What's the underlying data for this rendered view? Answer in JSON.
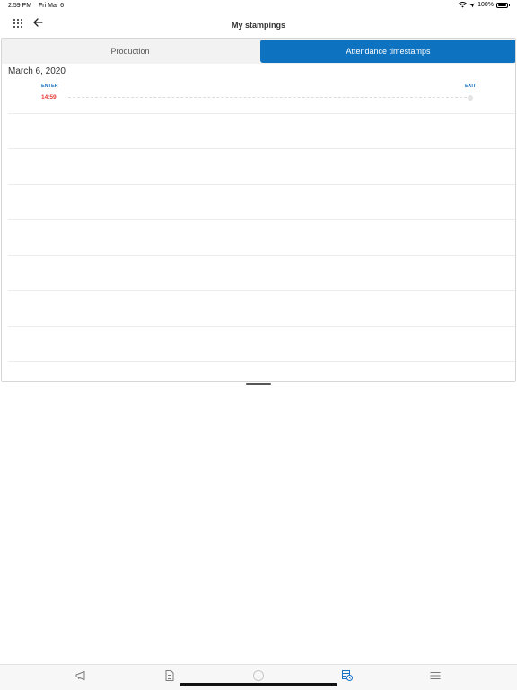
{
  "status_bar": {
    "time": "2:59 PM",
    "date": "Fri Mar 6",
    "battery": "100%"
  },
  "nav": {
    "title": "My stampings"
  },
  "tabs": [
    {
      "label": "Production",
      "selected": false
    },
    {
      "label": "Attendance timestamps",
      "selected": true
    }
  ],
  "colors": {
    "accent": "#0d72bf",
    "enter_time": "#e53935",
    "label": "#1a73c7"
  },
  "day": {
    "date": "March 6, 2020",
    "enter_label": "ENTER",
    "exit_label": "EXIT",
    "enter_time": "14:59"
  },
  "bottom_bar": {
    "icons": [
      "megaphone-icon",
      "document-icon",
      "circle-icon",
      "timesheet-clock-icon",
      "menu-icon"
    ],
    "active": "timesheet-clock-icon"
  }
}
